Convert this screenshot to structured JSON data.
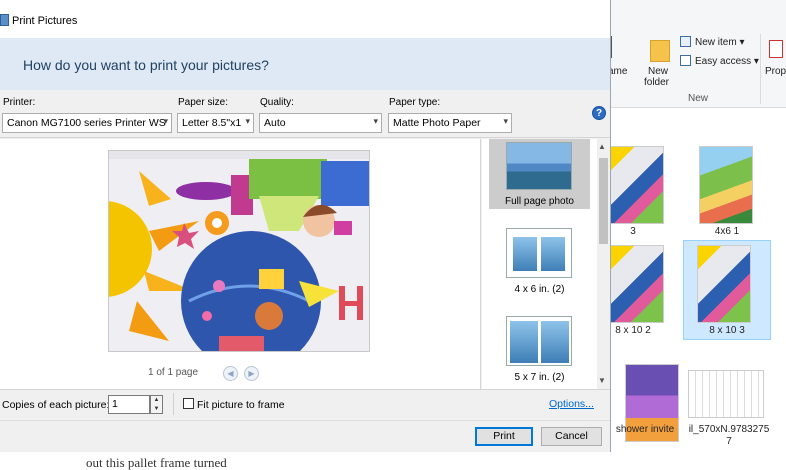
{
  "dialog": {
    "title": "Print Pictures",
    "question": "How do you want to print your pictures?",
    "printer": {
      "label": "Printer:",
      "value": "Canon MG7100 series Printer WS"
    },
    "paper_size": {
      "label": "Paper size:",
      "value": "Letter 8.5\"x1"
    },
    "quality": {
      "label": "Quality:",
      "value": "Auto"
    },
    "paper_type": {
      "label": "Paper type:",
      "value": "Matte Photo Paper"
    },
    "help_glyph": "?",
    "page_indicator": "1 of 1 page",
    "layouts": [
      {
        "label": "Full page photo",
        "selected": true
      },
      {
        "label": "4 x 6 in. (2)",
        "selected": false
      },
      {
        "label": "5 x 7 in. (2)",
        "selected": false
      }
    ],
    "copies_label": "Copies of each picture:",
    "copies_value": "1",
    "fit_label": "Fit picture to frame",
    "fit_checked": false,
    "options_link": "Options...",
    "print_button": "Print",
    "cancel_button": "Cancel"
  },
  "explorer": {
    "ribbon": {
      "rename_partial": "ame",
      "new_folder": "New",
      "new_folder_2": "folder",
      "new_item": "New item",
      "easy_access": "Easy access",
      "properties_partial": "Prop",
      "group_label": "New"
    },
    "files": [
      {
        "label": "3"
      },
      {
        "label": "4x6 1"
      },
      {
        "label": "8 x 10 2"
      },
      {
        "label": "8 x 10 3",
        "selected": true
      },
      {
        "label": "shower invite"
      },
      {
        "label": "il_570xN.9783275"
      },
      {
        "label": "7"
      }
    ]
  },
  "background_text": "out this pallet frame turned",
  "colors": {
    "header_bg": "#dee9f5",
    "accent": "#0078d7",
    "selection": "#cde8ff",
    "link": "#0066cc"
  }
}
